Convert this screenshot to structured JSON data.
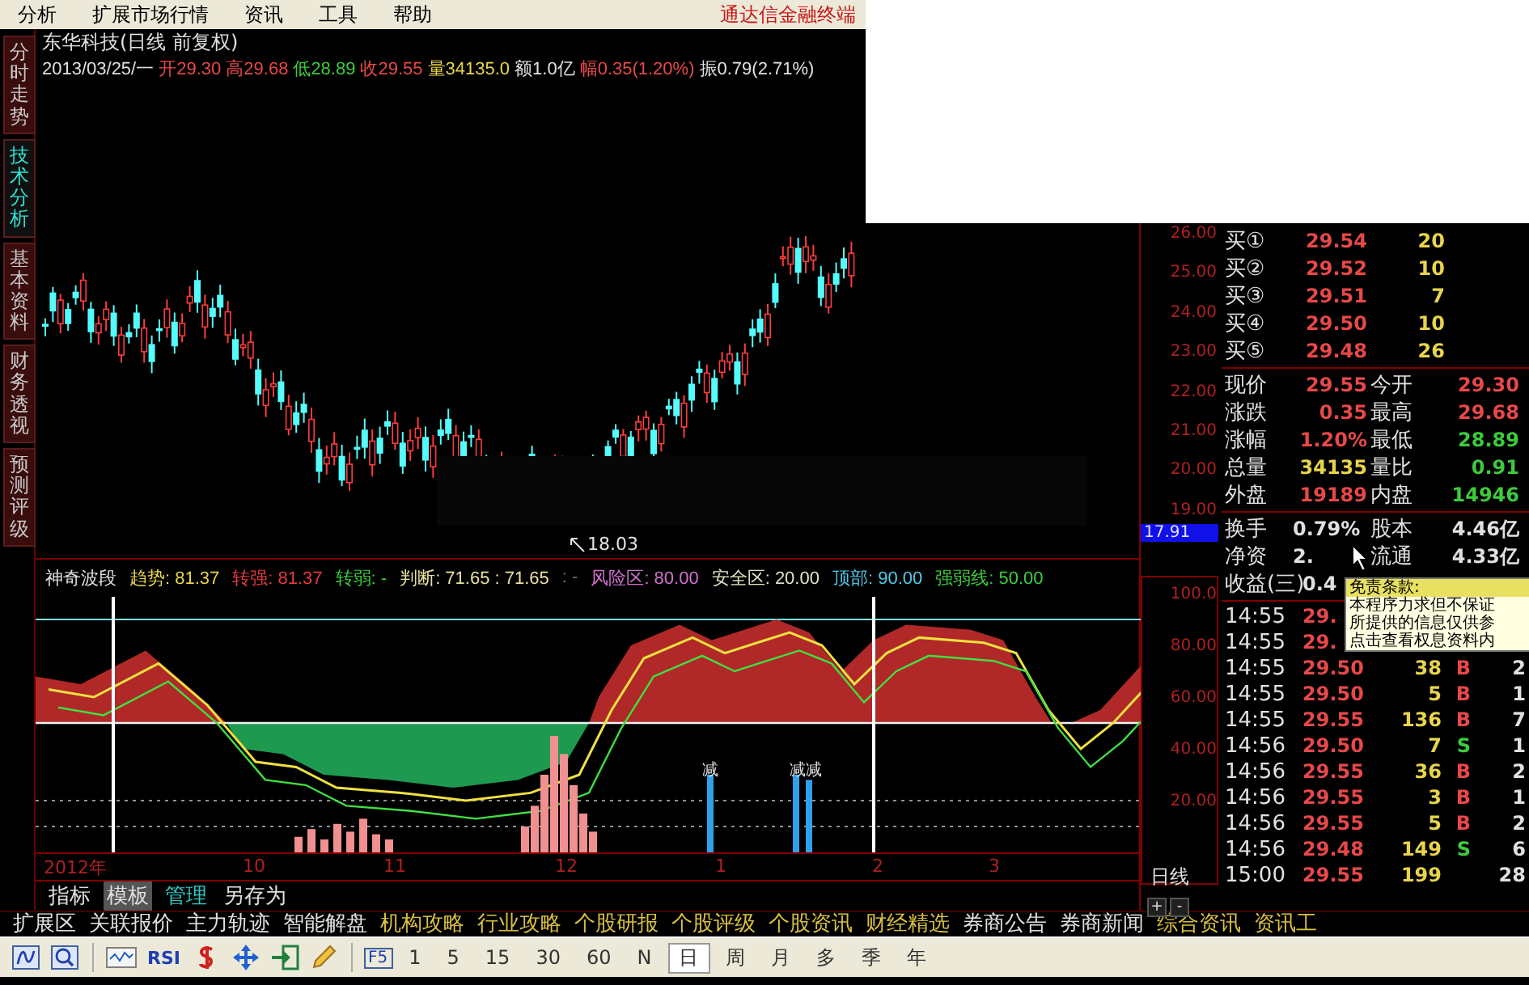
{
  "menu": {
    "items": [
      "分析",
      "扩展市场行情",
      "资讯",
      "工具",
      "帮助"
    ],
    "brand": "通达信金融终端"
  },
  "side_tabs": [
    {
      "label": "分时走势",
      "selected": false
    },
    {
      "label": "技术分析",
      "selected": true
    },
    {
      "label": "基本资料",
      "selected": false
    },
    {
      "label": "财务透视",
      "selected": false
    },
    {
      "label": "预测评级",
      "selected": false
    }
  ],
  "stock_header": {
    "title": "东华科技(日线 前复权)",
    "date": "2013/03/25/一",
    "fields": [
      {
        "text": "开29.30",
        "color": "#e84848"
      },
      {
        "text": "高29.68",
        "color": "#e84848"
      },
      {
        "text": "低28.89",
        "color": "#3ccc3c"
      },
      {
        "text": "收29.55",
        "color": "#e84848"
      },
      {
        "text": "量34135.0",
        "color": "#e8d44c"
      },
      {
        "text": "额1.0亿",
        "color": "#e0e0e0"
      },
      {
        "text": "幅0.35(1.20%)",
        "color": "#e84848"
      },
      {
        "text": "振0.79(2.71%)",
        "color": "#e0e0e0"
      }
    ]
  },
  "price_chart": {
    "low_marker": "18.03",
    "price_axis": [
      "26.00",
      "25.00",
      "24.00",
      "23.00",
      "22.00",
      "21.00",
      "20.00",
      "19.00"
    ],
    "price_tag": "17.91"
  },
  "indicator": {
    "name": "神奇波段",
    "values": [
      {
        "text": "趋势: 81.37",
        "color": "#e8d44c"
      },
      {
        "text": "转强: 81.37",
        "color": "#e83c3c"
      },
      {
        "text": "转弱: -",
        "color": "#3ccc3c"
      },
      {
        "text": "判断: 71.65 : 71.65",
        "color": "#e8e0a0"
      },
      {
        "text": ": -",
        "color": "#707070"
      },
      {
        "text": "风险区: 80.00",
        "color": "#d070d0"
      },
      {
        "text": "安全区: 20.00",
        "color": "#e0e0c0"
      },
      {
        "text": "顶部: 90.00",
        "color": "#50c8e8"
      },
      {
        "text": "强弱线: 50.00",
        "color": "#3ccc3c"
      }
    ],
    "signals": [
      "减",
      "减减"
    ],
    "axis": [
      "100.0",
      "80.00",
      "60.00",
      "40.00",
      "20.00"
    ]
  },
  "time_axis": [
    "2012年",
    "10",
    "11",
    "12",
    "1",
    "2",
    "3"
  ],
  "chart_tabs": [
    {
      "label": "指标",
      "selected": false,
      "kind": "plain"
    },
    {
      "label": "模板",
      "selected": true,
      "kind": "plain"
    },
    {
      "label": "管理",
      "selected": false,
      "kind": "highlight"
    },
    {
      "label": "另存为",
      "selected": false,
      "kind": "plain"
    }
  ],
  "period_label": "日线",
  "zoom_buttons": [
    "+",
    "-"
  ],
  "order_book": [
    {
      "label": "买①",
      "price": "29.54",
      "volume": "20"
    },
    {
      "label": "买②",
      "price": "29.52",
      "volume": "10"
    },
    {
      "label": "买③",
      "price": "29.51",
      "volume": "7"
    },
    {
      "label": "买④",
      "price": "29.50",
      "volume": "10"
    },
    {
      "label": "买⑤",
      "price": "29.48",
      "volume": "26"
    }
  ],
  "quotes": [
    {
      "cells": [
        {
          "label": "现价",
          "value": "29.55",
          "color": "#e84848"
        },
        {
          "label": "今开",
          "value": "29.30",
          "color": "#e84848"
        }
      ]
    },
    {
      "cells": [
        {
          "label": "涨跌",
          "value": "0.35",
          "color": "#e84848"
        },
        {
          "label": "最高",
          "value": "29.68",
          "color": "#e84848"
        }
      ]
    },
    {
      "cells": [
        {
          "label": "涨幅",
          "value": "1.20%",
          "color": "#e84848"
        },
        {
          "label": "最低",
          "value": "28.89",
          "color": "#3ccc3c"
        }
      ]
    },
    {
      "cells": [
        {
          "label": "总量",
          "value": "34135",
          "color": "#e8d44c"
        },
        {
          "label": "量比",
          "value": "0.91",
          "color": "#3ccc3c"
        }
      ]
    },
    {
      "cells": [
        {
          "label": "外盘",
          "value": "19189",
          "color": "#e84848"
        },
        {
          "label": "内盘",
          "value": "14946",
          "color": "#3ccc3c"
        }
      ]
    }
  ],
  "stats": [
    {
      "label": "换手",
      "value": "0.79%",
      "label2": "股本",
      "value2": "4.46亿"
    },
    {
      "label": "净资",
      "value": "2.",
      "label2": "流通",
      "value2": "4.33亿"
    },
    {
      "label": "收益(三)",
      "value": "0.4"
    }
  ],
  "trades": [
    {
      "time": "14:55",
      "price": "29."
    },
    {
      "time": "14:55",
      "price": "29."
    },
    {
      "time": "14:55",
      "price": "29.50",
      "volume": "38",
      "side": "B",
      "kind": "buy",
      "count": "2"
    },
    {
      "time": "14:55",
      "price": "29.50",
      "volume": "5",
      "side": "B",
      "kind": "buy",
      "count": "1"
    },
    {
      "time": "14:55",
      "price": "29.55",
      "volume": "136",
      "side": "B",
      "kind": "buy",
      "count": "7"
    },
    {
      "time": "14:56",
      "price": "29.50",
      "volume": "7",
      "side": "S",
      "kind": "sell",
      "count": "1"
    },
    {
      "time": "14:56",
      "price": "29.55",
      "volume": "36",
      "side": "B",
      "kind": "buy",
      "count": "2"
    },
    {
      "time": "14:56",
      "price": "29.55",
      "volume": "3",
      "side": "B",
      "kind": "buy",
      "count": "1"
    },
    {
      "time": "14:56",
      "price": "29.55",
      "volume": "5",
      "side": "B",
      "kind": "buy",
      "count": "2"
    },
    {
      "time": "14:56",
      "price": "29.48",
      "volume": "149",
      "side": "S",
      "kind": "sell",
      "count": "6"
    },
    {
      "time": "15:00",
      "price": "29.55",
      "volume": "199",
      "count": "28"
    }
  ],
  "tooltip": {
    "title": "免责条款:",
    "lines": [
      "本程序力求但不保证",
      "所提供的信息仅供参",
      "点击查看权息资料内"
    ]
  },
  "info_links": [
    {
      "label": "扩展区",
      "kind": "plain"
    },
    {
      "label": "关联报价",
      "kind": "plain"
    },
    {
      "label": "主力轨迹",
      "kind": "plain"
    },
    {
      "label": "智能解盘",
      "kind": "plain"
    },
    {
      "label": "机构攻略",
      "kind": "featured"
    },
    {
      "label": "行业攻略",
      "kind": "featured"
    },
    {
      "label": "个股研报",
      "kind": "featured"
    },
    {
      "label": "个股评级",
      "kind": "featured"
    },
    {
      "label": "个股资讯",
      "kind": "featured"
    },
    {
      "label": "财经精选",
      "kind": "featured"
    },
    {
      "label": "券商公告",
      "kind": "plain"
    },
    {
      "label": "券商新闻",
      "kind": "plain"
    },
    {
      "label": "综合资讯",
      "kind": "featured"
    },
    {
      "label": "资讯工",
      "kind": "featured"
    }
  ],
  "toolbar": {
    "rsi": "RSI",
    "f5": "F5",
    "periods": [
      {
        "label": "1",
        "selected": false
      },
      {
        "label": "5",
        "selected": false
      },
      {
        "label": "15",
        "selected": false
      },
      {
        "label": "30",
        "selected": false
      },
      {
        "label": "60",
        "selected": false
      },
      {
        "label": "N",
        "selected": false
      },
      {
        "label": "日",
        "selected": true
      },
      {
        "label": "周",
        "selected": false
      },
      {
        "label": "月",
        "selected": false
      },
      {
        "label": "多",
        "selected": false
      },
      {
        "label": "季",
        "selected": false
      },
      {
        "label": "年",
        "selected": false
      }
    ]
  }
}
